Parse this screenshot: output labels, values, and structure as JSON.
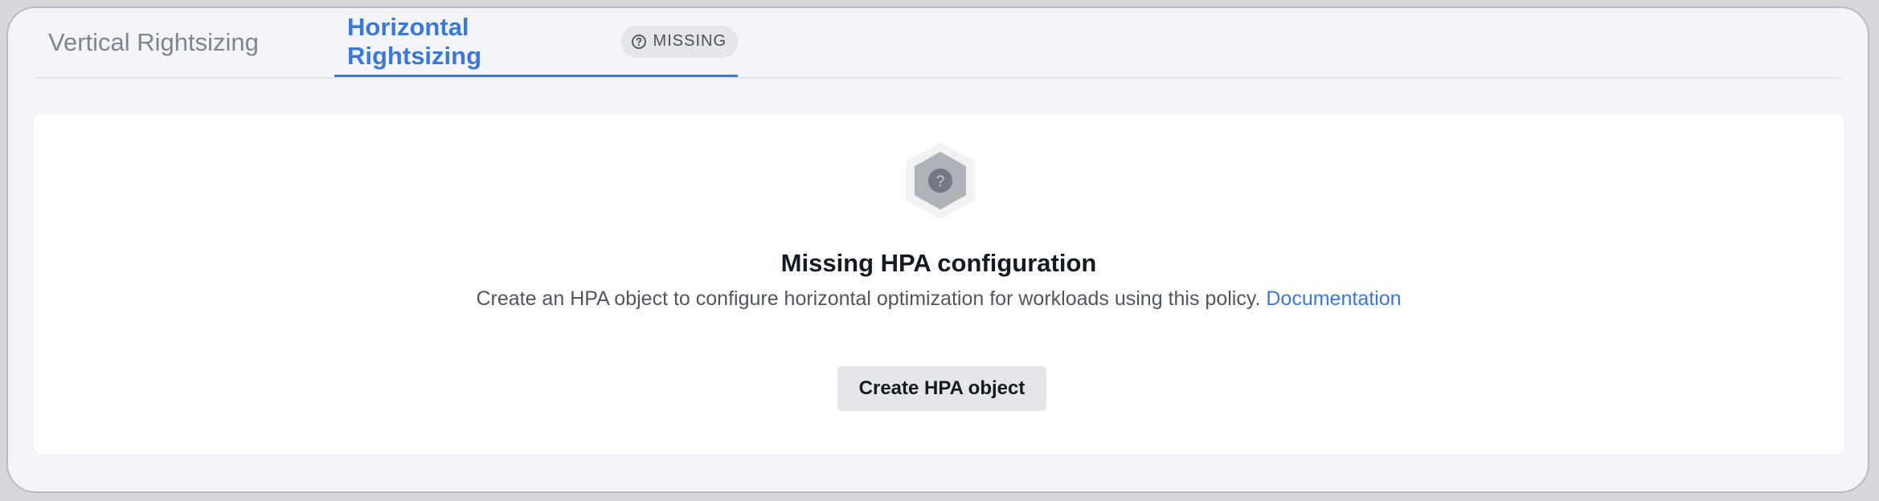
{
  "tabs": [
    {
      "label": "Vertical Rightsizing",
      "active": false
    },
    {
      "label": "Horizontal Rightsizing",
      "active": true,
      "badge": {
        "icon": "question-circle-icon",
        "label": "MISSING"
      }
    }
  ],
  "empty_state": {
    "icon": "hexagon-question-icon",
    "title": "Missing HPA configuration",
    "description": "Create an HPA object to configure horizontal optimization for workloads using this policy.",
    "link_label": "Documentation",
    "button_label": "Create HPA object"
  },
  "colors": {
    "accent": "#3b78d8",
    "background": "#f3f4f7",
    "panel": "#ffffff",
    "button_bg": "#e4e6ea",
    "inactive_tab": "#7d8590",
    "title": "#141a22"
  }
}
